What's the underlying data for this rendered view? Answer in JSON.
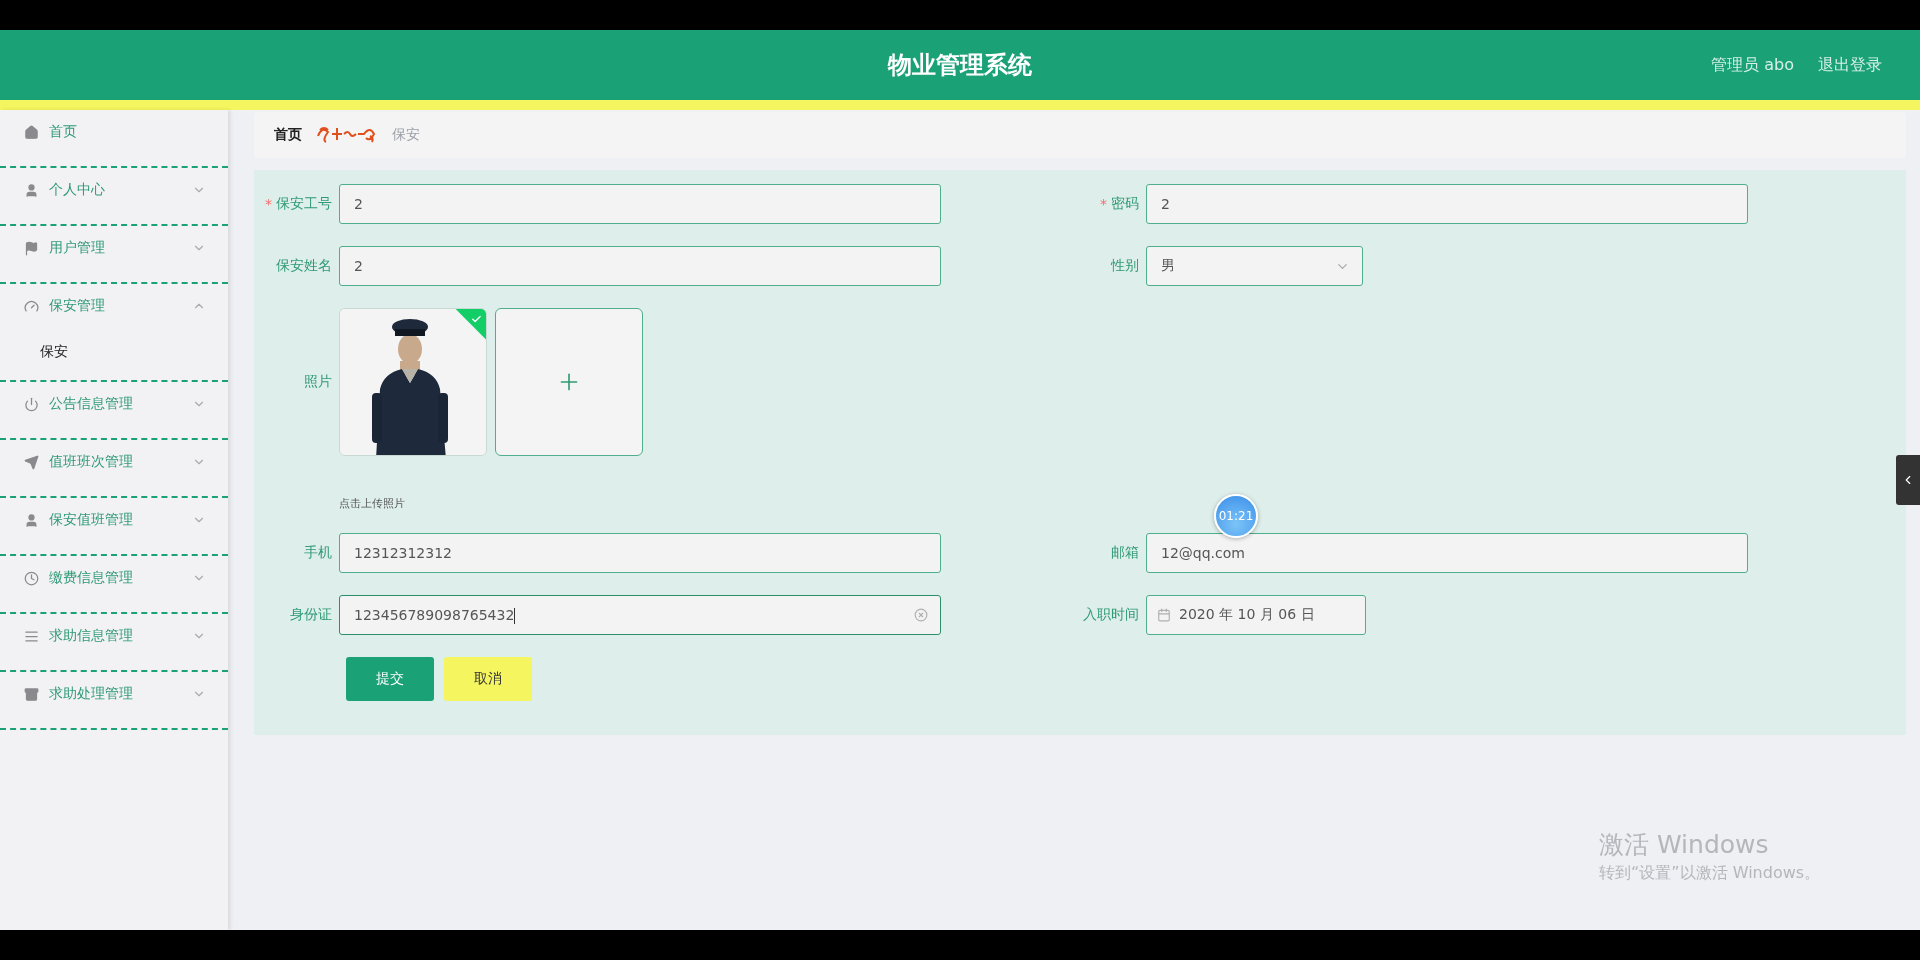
{
  "header": {
    "title": "物业管理系统",
    "user": "管理员 abo",
    "logout": "退出登录"
  },
  "sidebar": {
    "items": [
      {
        "label": "首页"
      },
      {
        "label": "个人中心",
        "expandable": true,
        "expanded": false
      },
      {
        "label": "用户管理",
        "expandable": true,
        "expanded": false
      },
      {
        "label": "保安管理",
        "expandable": true,
        "expanded": true,
        "children": [
          {
            "label": "保安"
          }
        ]
      },
      {
        "label": "公告信息管理",
        "expandable": true,
        "expanded": false
      },
      {
        "label": "值班班次管理",
        "expandable": true,
        "expanded": false
      },
      {
        "label": "保安值班管理",
        "expandable": true,
        "expanded": false
      },
      {
        "label": "缴费信息管理",
        "expandable": true,
        "expanded": false
      },
      {
        "label": "求助信息管理",
        "expandable": true,
        "expanded": false
      },
      {
        "label": "求助处理管理",
        "expandable": true,
        "expanded": false
      }
    ]
  },
  "breadcrumb": [
    {
      "label": "首页",
      "current": false
    },
    {
      "label": "保安",
      "current": true
    }
  ],
  "form": {
    "rows": [
      [
        {
          "kind": "text",
          "label": "保安工号",
          "asterisk": "*",
          "value": "2",
          "focused": false
        },
        {
          "kind": "text",
          "label": "密码",
          "asterisk": "*",
          "value": "2",
          "focused": false
        }
      ],
      [
        {
          "kind": "text",
          "label": "保安姓名",
          "value": "2",
          "focused": false
        },
        {
          "kind": "select",
          "label": "性别",
          "value": "男"
        }
      ],
      [
        {
          "kind": "upload",
          "label": "照片",
          "uploaded": true,
          "hint": "点击上传照片"
        }
      ],
      [
        {
          "kind": "text",
          "label": "手机",
          "value": "12312312312",
          "focused": false
        },
        {
          "kind": "text",
          "label": "邮箱",
          "value": "12@qq.com",
          "focused": false
        }
      ],
      [
        {
          "kind": "text",
          "label": "身份证",
          "value": "123456789098765432",
          "focused": true
        },
        {
          "kind": "date",
          "label": "入职时间",
          "value": "2020 年 10 月 06 日"
        }
      ]
    ],
    "buttons": [
      {
        "kind": "primary",
        "label": "提交"
      },
      {
        "kind": "secondary",
        "label": "取消"
      }
    ]
  },
  "timer": "01:21",
  "windows_notice": {
    "title": "激活 Windows",
    "subtitle": "转到“设置”以激活 Windows。"
  }
}
